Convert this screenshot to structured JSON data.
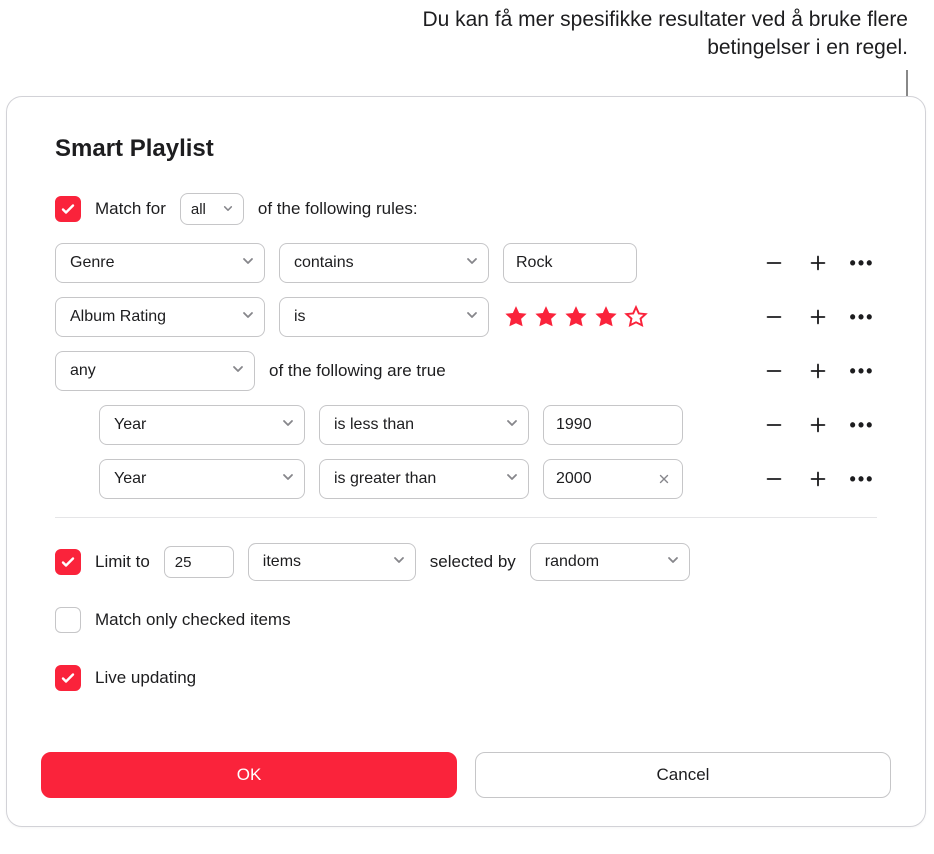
{
  "callout": {
    "text": "Du kan få mer spesifikke resultater ved å bruke flere betingelser i en regel."
  },
  "dialog": {
    "title": "Smart Playlist",
    "match": {
      "checked": true,
      "text_before": "Match for",
      "all_value": "all",
      "text_after": "of the following rules:"
    },
    "rules": [
      {
        "field": "Genre",
        "condition": "contains",
        "value": "Rock"
      },
      {
        "field": "Album Rating",
        "condition": "is",
        "stars_filled": 4,
        "stars_total": 5
      }
    ],
    "group": {
      "quantifier": "any",
      "text_after": "of the following are true",
      "rules": [
        {
          "field": "Year",
          "condition": "is less than",
          "value": "1990",
          "show_clear": false
        },
        {
          "field": "Year",
          "condition": "is greater than",
          "value": "2000",
          "show_clear": true
        }
      ]
    },
    "limit": {
      "checked": true,
      "label_before": "Limit to",
      "count": "25",
      "unit": "items",
      "label_mid": "selected by",
      "order": "random"
    },
    "match_only_checked": {
      "checked": false,
      "label": "Match only checked items"
    },
    "live_updating": {
      "checked": true,
      "label": "Live updating"
    },
    "buttons": {
      "ok": "OK",
      "cancel": "Cancel"
    }
  }
}
